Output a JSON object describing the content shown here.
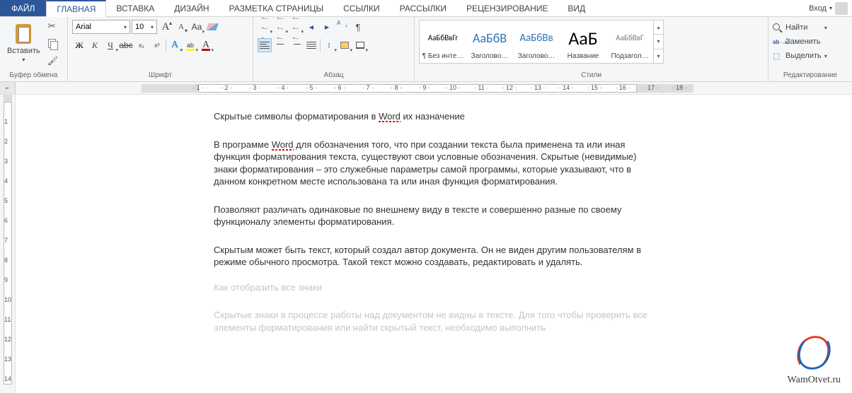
{
  "tabs": {
    "file": "ФАЙЛ",
    "items": [
      "ГЛАВНАЯ",
      "ВСТАВКА",
      "ДИЗАЙН",
      "РАЗМЕТКА СТРАНИЦЫ",
      "ССЫЛКИ",
      "РАССЫЛКИ",
      "РЕЦЕНЗИРОВАНИЕ",
      "ВИД"
    ],
    "active_index": 0,
    "login": "Вход"
  },
  "ribbon": {
    "clipboard": {
      "label": "Буфер обмена",
      "paste": "Вставить"
    },
    "font": {
      "label": "Шрифт",
      "name": "Arial",
      "size": "10",
      "grow": "A",
      "shrink": "A",
      "case": "Aa",
      "bold": "Ж",
      "italic": "К",
      "underline": "Ч",
      "strike": "abc",
      "sub": "x₂",
      "sup": "x²",
      "effects": "A",
      "highlight": "A",
      "color": "A"
    },
    "paragraph": {
      "label": "Абзац"
    },
    "styles": {
      "label": "Стили",
      "items": [
        {
          "name": "¶ Без инте…",
          "preview": "АаБбВвГг",
          "size": "12px",
          "color": "#333"
        },
        {
          "name": "Заголово…",
          "preview": "АаБбВ",
          "size": "18px",
          "color": "#2e74b5"
        },
        {
          "name": "Заголово…",
          "preview": "АаБбВв",
          "size": "15px",
          "color": "#2e74b5"
        },
        {
          "name": "Название",
          "preview": "АаБ",
          "size": "26px",
          "color": "#333"
        },
        {
          "name": "Подзагол…",
          "preview": "АаБбВвГ",
          "size": "12px",
          "color": "#777"
        }
      ]
    },
    "editing": {
      "label": "Редактирование",
      "find": "Найти",
      "replace": "Заменить",
      "select": "Выделить"
    }
  },
  "ruler": {
    "marks": [
      1,
      2,
      3,
      4,
      5,
      6,
      7,
      8,
      9,
      10,
      11,
      12,
      13,
      14,
      15,
      16,
      17,
      18
    ]
  },
  "document": {
    "p1_a": "Скрытые символы форматирования в ",
    "p1_w": "Word",
    "p1_b": " их назначение",
    "p2_a": "В программе ",
    "p2_w": "Word",
    "p2_b": " для обозначения того, что при создании текста была применена та или иная функция форматирования текста, существуют свои условные обозначения. Скрытые (невидимые) знаки форматирования – это служебные параметры самой программы, которые указывают, что в данном конкретном месте использована та или иная функция форматирования.",
    "p3": "Позволяют различать одинаковые по внешнему виду в тексте и совершенно разные по своему функционалу элементы форматирования.",
    "p4": "Скрытым может быть текст, который создал автор документа. Он не виден другим пользователям в режиме обычного просмотра. Такой текст можно создавать, редактировать и удалять.",
    "p5": "Как отобразить все знаки",
    "p6": "Скрытые знаки в процессе работы над документом не видны в тексте. Для того чтобы проверить все элементы форматирования или найти скрытый текст, необходимо выполнить"
  },
  "watermark": "WamOtvet.ru"
}
